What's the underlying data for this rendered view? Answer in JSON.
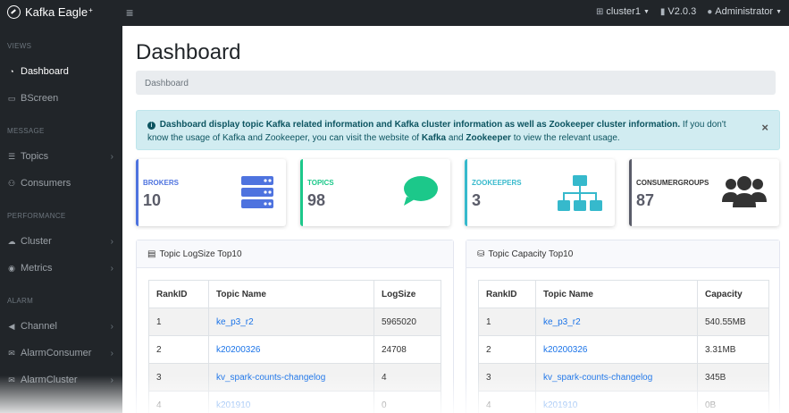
{
  "topbar": {
    "brand": "Kafka Eagle",
    "brand_sup": "+",
    "cluster": "cluster1",
    "version": "V2.0.3",
    "user": "Administrator"
  },
  "sidebar": {
    "sections": [
      {
        "title": "VIEWS"
      },
      {
        "title": "MESSAGE"
      },
      {
        "title": "PERFORMANCE"
      },
      {
        "title": "ALARM"
      }
    ],
    "items": [
      {
        "label": "Dashboard",
        "icon": "dashboard-icon"
      },
      {
        "label": "BScreen",
        "icon": "monitor-icon"
      },
      {
        "label": "Topics",
        "icon": "list-icon"
      },
      {
        "label": "Consumers",
        "icon": "users-icon"
      },
      {
        "label": "Cluster",
        "icon": "cloud-icon"
      },
      {
        "label": "Metrics",
        "icon": "eye-icon"
      },
      {
        "label": "Channel",
        "icon": "bullhorn-icon"
      },
      {
        "label": "AlarmConsumer",
        "icon": "envelope-icon"
      },
      {
        "label": "AlarmCluster",
        "icon": "envelope-icon"
      }
    ]
  },
  "main": {
    "title": "Dashboard",
    "breadcrumb": "Dashboard",
    "alert": {
      "bold_text": "Dashboard display topic Kafka related information and Kafka cluster information as well as Zookeeper cluster information.",
      "text_1": " If you don't know the usage of Kafka and Zookeeper, you can visit the website of ",
      "bold_kafka": "Kafka",
      "text_2": " and ",
      "bold_zookeeper": "Zookeeper",
      "text_3": " to view the relevant usage."
    },
    "cards": [
      {
        "label": "BROKERS",
        "value": "10",
        "color": "#4e73df"
      },
      {
        "label": "TOPICS",
        "value": "98",
        "color": "#1cc88a"
      },
      {
        "label": "ZOOKEEPERS",
        "value": "3",
        "color": "#36b9cc"
      },
      {
        "label": "CONSUMERGROUPS",
        "value": "87",
        "color": "#5a5c69"
      }
    ],
    "logsize_panel": {
      "title": "Topic LogSize Top10",
      "columns": [
        "RankID",
        "Topic Name",
        "LogSize"
      ],
      "rows": [
        [
          "1",
          "ke_p3_r2",
          "5965020"
        ],
        [
          "2",
          "k20200326",
          "24708"
        ],
        [
          "3",
          "kv_spark-counts-changelog",
          "4"
        ],
        [
          "4",
          "k201910",
          "0"
        ]
      ]
    },
    "capacity_panel": {
      "title": "Topic Capacity Top10",
      "columns": [
        "RankID",
        "Topic Name",
        "Capacity"
      ],
      "rows": [
        [
          "1",
          "ke_p3_r2",
          "540.55MB"
        ],
        [
          "2",
          "k20200326",
          "3.31MB"
        ],
        [
          "3",
          "kv_spark-counts-changelog",
          "345B"
        ],
        [
          "4",
          "k201910",
          "0B"
        ]
      ]
    }
  }
}
